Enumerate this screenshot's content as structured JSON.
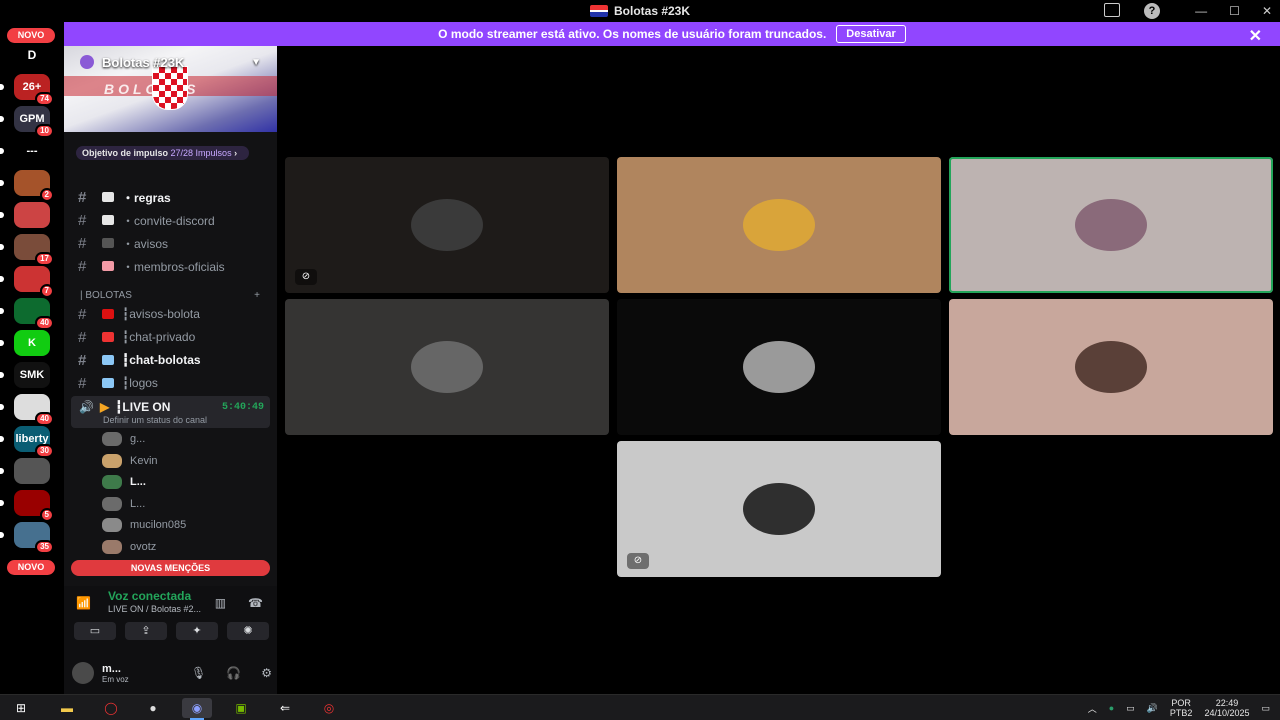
{
  "window": {
    "title": "Bolotas #23K"
  },
  "streamer_banner": {
    "message": "O modo streamer está ativo. Os nomes de usuário foram truncados.",
    "button": "Desativar"
  },
  "guilds": {
    "top_letter": "D",
    "novo_label": "NOVO",
    "items": [
      {
        "label": "26+",
        "badge": "74",
        "color": "#b22"
      },
      {
        "label": "GPM",
        "badge": "10",
        "color": "#334"
      },
      {
        "label": "---",
        "badge": "",
        "color": "#000"
      },
      {
        "label": "",
        "badge": "2",
        "color": "#a5532a"
      },
      {
        "label": "",
        "badge": "",
        "color": "#c44"
      },
      {
        "label": "",
        "badge": "17",
        "color": "#7a4c3a"
      },
      {
        "label": "",
        "badge": "7",
        "color": "#c33"
      },
      {
        "label": "",
        "badge": "40",
        "color": "#0d6b2f"
      },
      {
        "label": "K",
        "badge": "",
        "color": "#1c1"
      },
      {
        "label": "SMK",
        "badge": "",
        "color": "#111"
      },
      {
        "label": "",
        "badge": "40",
        "color": "#ddd"
      },
      {
        "label": "liberty",
        "badge": "30",
        "color": "#0a5d73"
      },
      {
        "label": "",
        "badge": "",
        "color": "#555"
      },
      {
        "label": "",
        "badge": "5",
        "color": "#900"
      },
      {
        "label": "",
        "badge": "35",
        "color": "#46708f"
      }
    ]
  },
  "server": {
    "name": "Bolotas #23K",
    "banner_word": "BOLOTAS",
    "boost_label": "Objetivo de impulso",
    "boost_count": "27/28 Impulsos"
  },
  "channels_top": [
    {
      "name": "・regras",
      "bold": true,
      "emo": "#e6e6e6"
    },
    {
      "name": "・convite-discord",
      "bold": false,
      "emo": "#e6e6e6"
    },
    {
      "name": "・avisos",
      "bold": false,
      "emo": "#555"
    },
    {
      "name": "・membros-oficiais",
      "bold": false,
      "emo": "#f29aa6"
    }
  ],
  "category": {
    "name": "| BOLOTAS",
    "add": "+"
  },
  "channels_cat": [
    {
      "name": "┇avisos-bolota",
      "bold": false,
      "emo": "#d11"
    },
    {
      "name": "┇chat-privado",
      "bold": false,
      "emo": "#e33"
    },
    {
      "name": "┇chat-bolotas",
      "bold": true,
      "emo": "#8bc7f5"
    },
    {
      "name": "┇logos",
      "bold": false,
      "emo": "#8bc7f5"
    }
  ],
  "voice_channel": {
    "name": "┇LIVE ON",
    "timer": "5:40:49",
    "status": "Definir um status do canal"
  },
  "members": [
    {
      "name": "g...",
      "bold": false
    },
    {
      "name": "Kevin",
      "bold": false
    },
    {
      "name": "L...",
      "bold": true
    },
    {
      "name": "L...",
      "bold": false
    },
    {
      "name": "mucilon085",
      "bold": false
    },
    {
      "name": "ovotz",
      "bold": false
    }
  ],
  "mentions_label": "NOVAS MENÇÕES",
  "voice_panel": {
    "title": "Voz conectada",
    "subtitle": "LIVE ON / Bolotas #2..."
  },
  "user_panel": {
    "name": "m...",
    "status": "Em voz"
  },
  "tiles": [
    {
      "bg": "#1e1b19",
      "avatar": "#3a3a3a",
      "nocam": true,
      "speaking": false
    },
    {
      "bg": "#b0855e",
      "avatar": "#d9a43a",
      "nocam": false,
      "speaking": false
    },
    {
      "bg": "#bdb3b1",
      "avatar": "#8a6a7a",
      "nocam": false,
      "speaking": true
    },
    {
      "bg": "#353433",
      "avatar": "#666",
      "nocam": false,
      "speaking": false
    },
    {
      "bg": "#0a0a0a",
      "avatar": "#9a9a9a",
      "nocam": false,
      "speaking": false
    },
    {
      "bg": "#c8a79c",
      "avatar": "#5a4038",
      "nocam": false,
      "speaking": false
    },
    {
      "bg": "#c9c9c9",
      "avatar": "#2f2f2f",
      "nocam": true,
      "speaking": false
    }
  ],
  "taskbar": {
    "lang_top": "POR",
    "lang_bottom": "PTB2",
    "time": "22:49",
    "date": "24/10/2025"
  }
}
